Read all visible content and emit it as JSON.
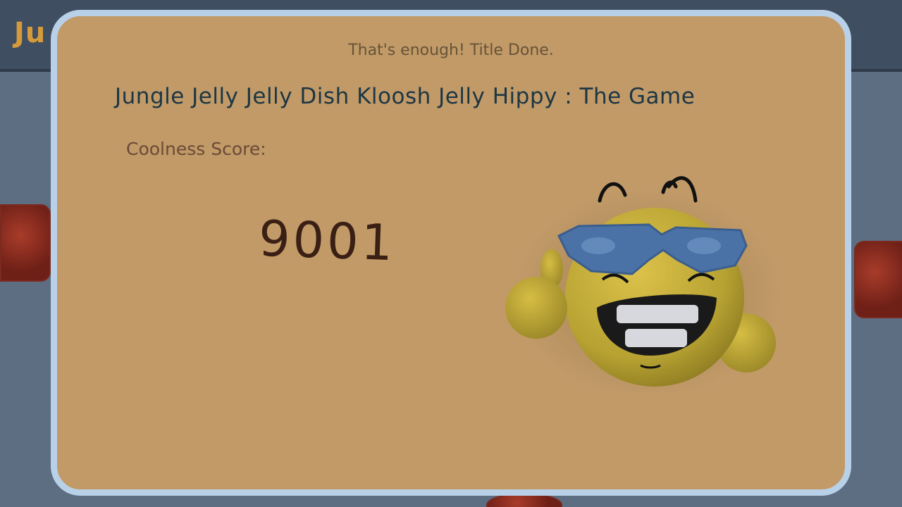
{
  "background": {
    "top_bar_title": "Ju"
  },
  "dialog": {
    "caption": "That's enough! Title Done.",
    "title": "Jungle Jelly Jelly Dish Kloosh Jelly Hippy : The Game",
    "score_label": "Coolness Score:",
    "score_value": "9001"
  },
  "mascot": {
    "icon": "cool-emoji-sunglasses-thumbs-up-icon"
  },
  "colors": {
    "panel": "#c19a68",
    "panel_border": "#b9d1e8",
    "title_text": "#1c3644",
    "score_text": "#3a1f14",
    "background": "#5d6d82"
  }
}
